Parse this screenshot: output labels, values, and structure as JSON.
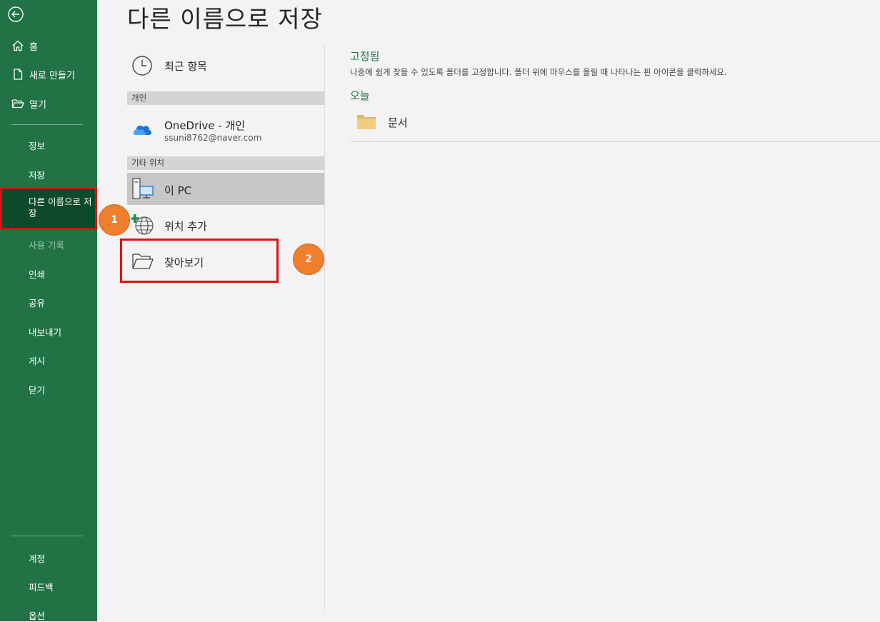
{
  "sidebar": {
    "top_items": [
      {
        "label": "홈",
        "icon": "home-icon"
      },
      {
        "label": "새로 만들기",
        "icon": "new-document-icon"
      },
      {
        "label": "열기",
        "icon": "open-folder-icon"
      }
    ],
    "items": [
      {
        "label": "정보"
      },
      {
        "label": "저장"
      },
      {
        "label": "다른 이름으로 저장",
        "selected": true
      },
      {
        "label": "사용 기록",
        "disabled": true
      },
      {
        "label": "인쇄"
      },
      {
        "label": "공유"
      },
      {
        "label": "내보내기"
      },
      {
        "label": "게시"
      },
      {
        "label": "닫기"
      }
    ],
    "bottom_items": [
      {
        "label": "계정"
      },
      {
        "label": "피드백"
      },
      {
        "label": "옵션"
      }
    ]
  },
  "page": {
    "title": "다른 이름으로 저장"
  },
  "locations": {
    "recent": "최근 항목",
    "personal_header": "개인",
    "onedrive_label": "OneDrive - 개인",
    "onedrive_email": "ssuni8762@naver.com",
    "other_header": "기타 위치",
    "this_pc": "이 PC",
    "add_place": "위치 추가",
    "browse": "찾아보기"
  },
  "right": {
    "pinned_title": "고정됨",
    "pinned_desc": "나중에 쉽게 찾을 수 있도록 폴더를 고정합니다. 폴더 위에 마우스를 올릴 때 나타나는 핀 아이콘을 클릭하세요.",
    "today_title": "오늘",
    "folders": [
      {
        "name": "문서"
      }
    ]
  },
  "annotations": {
    "step1": "1",
    "step2": "2"
  },
  "colors": {
    "sidebar": "#217346",
    "selected": "#0c4a29",
    "highlight": "#e01010",
    "badge": "#ef7f2d",
    "accent": "#217346"
  }
}
